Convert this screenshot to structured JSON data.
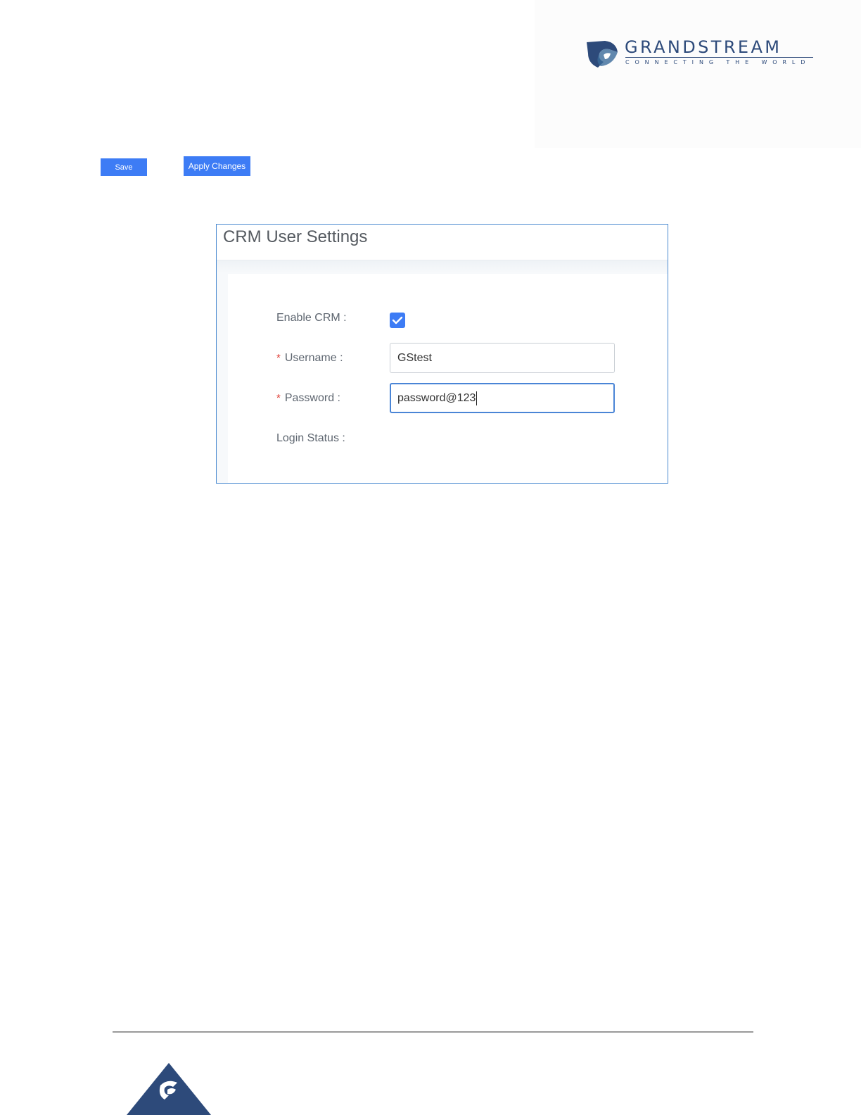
{
  "brand": {
    "wordmark": "GRANDSTREAM",
    "tagline": "CONNECTING THE WORLD",
    "color": "#2d4a7a"
  },
  "toolbar": {
    "save_label": "Save",
    "apply_label": "Apply Changes",
    "accent": "#3d7cf5"
  },
  "panel": {
    "title": "CRM User Settings",
    "fields": {
      "enable_crm": {
        "label": "Enable CRM",
        "checked": true
      },
      "username": {
        "label": "Username",
        "required_mark": "*",
        "value": "GStest"
      },
      "password": {
        "label": "Password",
        "required_mark": "*",
        "value": "password@123"
      },
      "login_status": {
        "label": "Login Status",
        "value": ""
      }
    },
    "label_suffix": ":"
  },
  "icons": {
    "logo": "grandstream-logo-icon",
    "check": "check-icon",
    "footer": "grandstream-footer-icon"
  }
}
